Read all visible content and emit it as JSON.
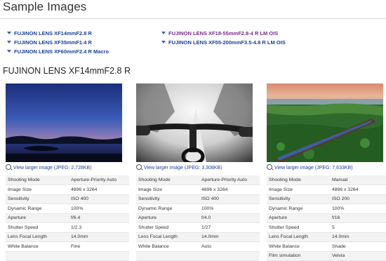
{
  "page": {
    "title": "Sample Images"
  },
  "lens_links": {
    "left": [
      {
        "label": "FUJINON LENS XF14mmF2.8 R",
        "visited": false
      },
      {
        "label": "FUJINON LENS XF35mmF1.4 R",
        "visited": false
      },
      {
        "label": "FUJINON LENS XF60mmF2.4 R Macro",
        "visited": false
      }
    ],
    "right": [
      {
        "label": "FUJINON LENS XF18-55mmF2.8-4 R LM OIS",
        "visited": true
      },
      {
        "label": "FUJINON LENS XF55-200mmF3.5-4.8 R LM OIS",
        "visited": false
      }
    ]
  },
  "section": {
    "heading": "FUJINON LENS XF14mmF2.8 R"
  },
  "samples": [
    {
      "image_alt": "Twilight lake landscape",
      "link_text": "View larger image (JPEG: 2,728KB)",
      "specs": [
        {
          "label": "Shooting Mode",
          "value": "Aperture-Priority Auto"
        },
        {
          "label": "Image Size",
          "value": "4896 x 3264"
        },
        {
          "label": "Sensitivity",
          "value": "ISO 400"
        },
        {
          "label": "Dynamic Range",
          "value": "100%"
        },
        {
          "label": "Aperture",
          "value": "f/6.4"
        },
        {
          "label": "Shutter Speed",
          "value": "1/2.3"
        },
        {
          "label": "Lens Focal Length",
          "value": "14.0mm"
        },
        {
          "label": "White Balance",
          "value": "Fine"
        },
        {
          "label": "",
          "value": ""
        }
      ]
    },
    {
      "image_alt": "Mountain bike handlebars on snowy trail",
      "link_text": "View larger image (JPEG: 3,308KB)",
      "specs": [
        {
          "label": "Shooting Mode",
          "value": "Aperture-Priority Auto"
        },
        {
          "label": "Image Size",
          "value": "4896 x 3264"
        },
        {
          "label": "Sensitivity",
          "value": "ISO 400"
        },
        {
          "label": "Dynamic Range",
          "value": "100%"
        },
        {
          "label": "Aperture",
          "value": "f/4.0"
        },
        {
          "label": "Shutter Speed",
          "value": "1/27"
        },
        {
          "label": "Lens Focal Length",
          "value": "14.0mm"
        },
        {
          "label": "White Balance",
          "value": "Auto"
        },
        {
          "label": "",
          "value": ""
        }
      ]
    },
    {
      "image_alt": "Boat on lake with water hyacinths at sunset",
      "link_text": "View larger image (JPEG: 7,633KB)",
      "specs": [
        {
          "label": "Shooting Mode",
          "value": "Manual"
        },
        {
          "label": "Image Size",
          "value": "4896 x 3264"
        },
        {
          "label": "Sensitivity",
          "value": "ISO 200"
        },
        {
          "label": "Dynamic Range",
          "value": "100%"
        },
        {
          "label": "Aperture",
          "value": "f/16"
        },
        {
          "label": "Shutter Speed",
          "value": "5"
        },
        {
          "label": "Lens Focal Length",
          "value": "14.0mm"
        },
        {
          "label": "White Balance",
          "value": "Shade"
        },
        {
          "label": "Film simulation",
          "value": "Velvia"
        }
      ]
    }
  ],
  "colors": {
    "link": "#1a3f9a",
    "visited_link": "#7a2c91",
    "alt_row": "#f3f3f3",
    "rule": "#dcdcdc"
  },
  "icons": {
    "bullet": "triangle-down-bullet-icon",
    "larger_image": "magnifier-icon"
  }
}
